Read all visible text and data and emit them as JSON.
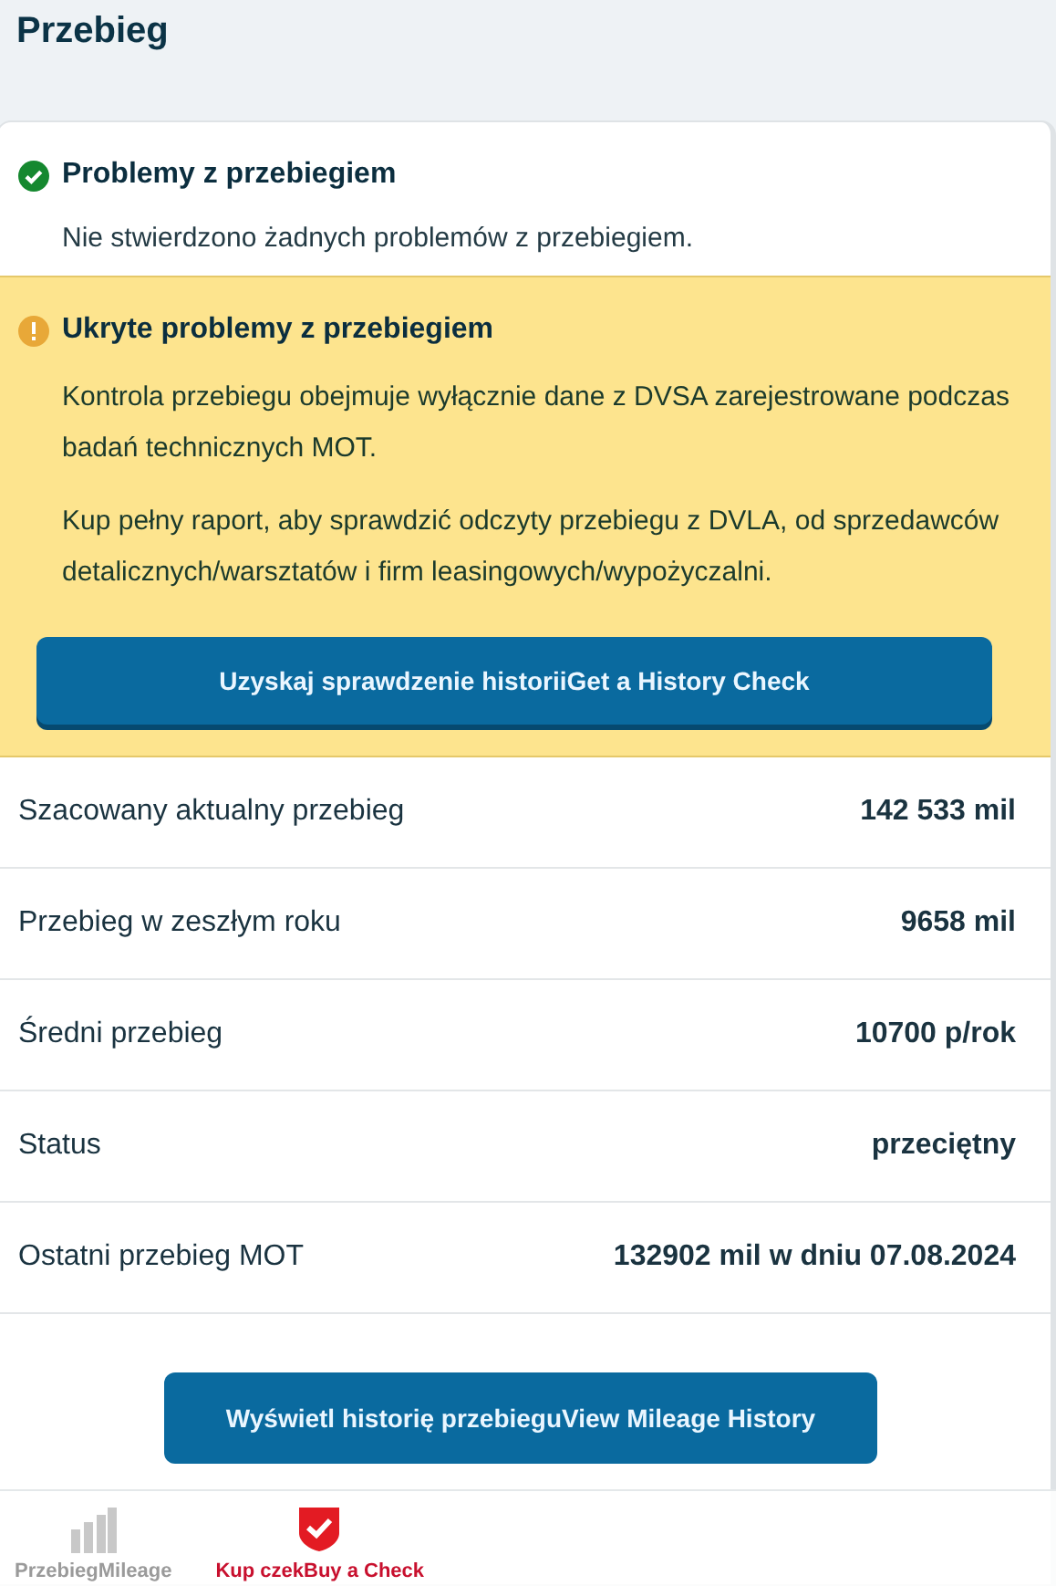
{
  "page_title": "Przebieg",
  "ok_notice": {
    "title": "Problemy z przebiegiem",
    "text": "Nie stwierdzono żadnych problemów z przebiegiem."
  },
  "warning_notice": {
    "title": "Ukryte problemy z przebiegiem",
    "paragraphs": [
      "Kontrola przebiegu obejmuje wyłącznie dane z DVSA zarejestrowane podczas badań technicznych MOT.",
      "Kup pełny raport, aby sprawdzić odczyty przebiegu z DVLA, od sprzedawców detalicznych/warsztatów i firm leasingowych/wypożyczalni."
    ],
    "button": "Uzyskaj sprawdzenie historiiGet a History Check"
  },
  "rows": [
    {
      "label": "Szacowany aktualny przebieg",
      "value": "142 533 mil"
    },
    {
      "label": "Przebieg w zeszłym roku",
      "value": "9658 mil"
    },
    {
      "label": "Średni przebieg",
      "value": "10700 p/rok"
    },
    {
      "label": "Status",
      "value": "przeciętny"
    },
    {
      "label": "Ostatni przebieg MOT",
      "value": "132902 mil w dniu 07.08.2024"
    }
  ],
  "history_button": "Wyświetl historię przebieguView Mileage History",
  "bottom_nav": [
    {
      "kind": "chart",
      "label": "PrzebiegMileage",
      "selected": false
    },
    {
      "kind": "shield",
      "label": "Kup czekBuy a Check",
      "selected": true
    }
  ]
}
